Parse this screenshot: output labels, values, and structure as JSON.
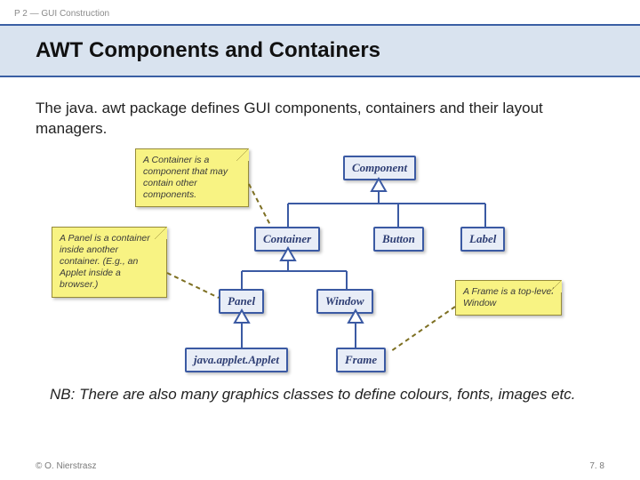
{
  "header": {
    "breadcrumb": "P 2 — GUI Construction"
  },
  "title": "AWT Components and Containers",
  "body": {
    "lead": "The java. awt package defines GUI components, containers and their layout managers.",
    "nb_prefix": "NB:",
    "nb_rest": " There are also many graphics classes to define colours, fonts, images etc."
  },
  "diagram": {
    "nodes": {
      "component": "Component",
      "container": "Container",
      "button": "Button",
      "label": "Label",
      "panel": "Panel",
      "window": "Window",
      "applet": "java.applet.Applet",
      "frame": "Frame"
    },
    "notes": {
      "container_note": "A Container is a component that may contain other components.",
      "panel_note": "A Panel is a container inside another container. (E.g., an Applet inside a browser.)",
      "frame_note": "A Frame is a top-level Window"
    }
  },
  "footer": {
    "copyright": "© O. Nierstrasz",
    "page": "7. 8"
  }
}
